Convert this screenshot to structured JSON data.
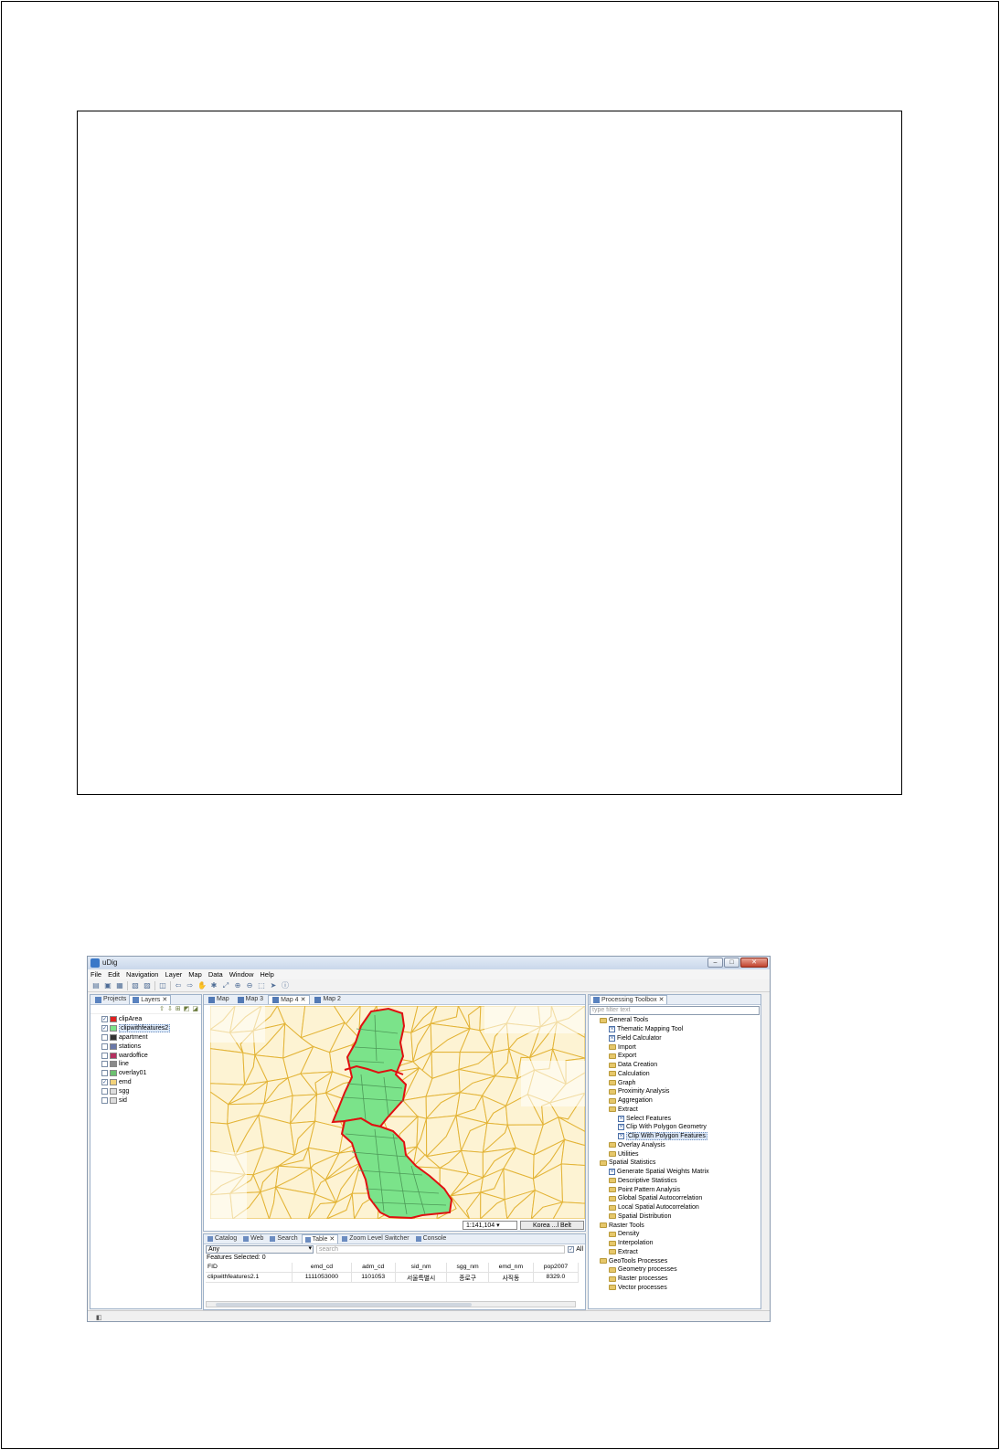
{
  "window": {
    "title": "uDig"
  },
  "window_buttons": [
    "–",
    "□",
    "✕"
  ],
  "menu": [
    "File",
    "Edit",
    "Navigation",
    "Layer",
    "Map",
    "Data",
    "Window",
    "Help"
  ],
  "left_panel": {
    "tabs": [
      "Projects",
      "Layers"
    ],
    "layers": [
      {
        "name": "clipArea",
        "checked": true
      },
      {
        "name": "clipwithfeatures2",
        "checked": true,
        "selected": true
      },
      {
        "name": "apartment",
        "checked": false
      },
      {
        "name": "stations",
        "checked": false
      },
      {
        "name": "wardoffice",
        "checked": false
      },
      {
        "name": "line",
        "checked": false
      },
      {
        "name": "overlay01",
        "checked": false
      },
      {
        "name": "emd",
        "checked": true
      },
      {
        "name": "sgg",
        "checked": false
      },
      {
        "name": "sid",
        "checked": false
      }
    ]
  },
  "map_tabs": [
    "Map",
    "Map 3",
    "Map 4",
    "Map 2"
  ],
  "map_status": {
    "scale": "1:141,104",
    "crs": "Korea ...l Belt"
  },
  "map_colors": {
    "base_fill": "#fdf3d3",
    "base_line": "#e3b437",
    "clip_fill": "#7be38a",
    "clip_line": "#e01010"
  },
  "bottom_tabs": [
    "Catalog",
    "Web",
    "Search",
    "Table",
    "Zoom Level Switcher",
    "Console"
  ],
  "table": {
    "filter": "Any",
    "search_placeholder": "search",
    "all_label": "All",
    "selected_text": "Features Selected: 0",
    "columns": [
      "FID",
      "emd_cd",
      "adm_cd",
      "sid_nm",
      "sgg_nm",
      "emd_nm",
      "pop2007"
    ],
    "rows": [
      [
        "clipwithfeatures2.1",
        "1111053000",
        "1101053",
        "서울특별시",
        "종로구",
        "사직동",
        "8329.0"
      ]
    ]
  },
  "toolbox": {
    "title": "Processing Toolbox",
    "filter_placeholder": "type filter text",
    "items": [
      {
        "label": "General Tools",
        "type": "folder",
        "level": 0
      },
      {
        "label": "Thematic Mapping Tool",
        "type": "tool",
        "level": 1
      },
      {
        "label": "Field Calculator",
        "type": "tool",
        "level": 1
      },
      {
        "label": "Import",
        "type": "folder",
        "level": 1
      },
      {
        "label": "Export",
        "type": "folder",
        "level": 1
      },
      {
        "label": "Data Creation",
        "type": "folder",
        "level": 1
      },
      {
        "label": "Calculation",
        "type": "folder",
        "level": 1
      },
      {
        "label": "Graph",
        "type": "folder",
        "level": 1
      },
      {
        "label": "Proximity Analysis",
        "type": "folder",
        "level": 1
      },
      {
        "label": "Aggregation",
        "type": "folder",
        "level": 1
      },
      {
        "label": "Extract",
        "type": "folder",
        "level": 1
      },
      {
        "label": "Select Features",
        "type": "tool",
        "level": 2
      },
      {
        "label": "Clip With Polygon Geometry",
        "type": "tool",
        "level": 2
      },
      {
        "label": "Clip With Polygon Features",
        "type": "tool",
        "level": 2,
        "highlight": true
      },
      {
        "label": "Overlay Analysis",
        "type": "folder",
        "level": 1
      },
      {
        "label": "Utilities",
        "type": "folder",
        "level": 1
      },
      {
        "label": "Spatial Statistics",
        "type": "folder",
        "level": 0
      },
      {
        "label": "Generate Spatial Weights Matrix",
        "type": "tool",
        "level": 1
      },
      {
        "label": "Descriptive Statistics",
        "type": "folder",
        "level": 1
      },
      {
        "label": "Point Pattern Analysis",
        "type": "folder",
        "level": 1
      },
      {
        "label": "Global Spatial Autocorrelation",
        "type": "folder",
        "level": 1
      },
      {
        "label": "Local Spatial Autocorrelation",
        "type": "folder",
        "level": 1
      },
      {
        "label": "Spatial Distribution",
        "type": "folder",
        "level": 1
      },
      {
        "label": "Raster Tools",
        "type": "folder",
        "level": 0
      },
      {
        "label": "Density",
        "type": "folder",
        "level": 1
      },
      {
        "label": "Interpolation",
        "type": "folder",
        "level": 1
      },
      {
        "label": "Extract",
        "type": "folder",
        "level": 1
      },
      {
        "label": "GeoTools Processes",
        "type": "folder",
        "level": 0
      },
      {
        "label": "Geometry processes",
        "type": "folder",
        "level": 1
      },
      {
        "label": "Raster processes",
        "type": "folder",
        "level": 1
      },
      {
        "label": "Vector processes",
        "type": "folder",
        "level": 1
      }
    ]
  }
}
